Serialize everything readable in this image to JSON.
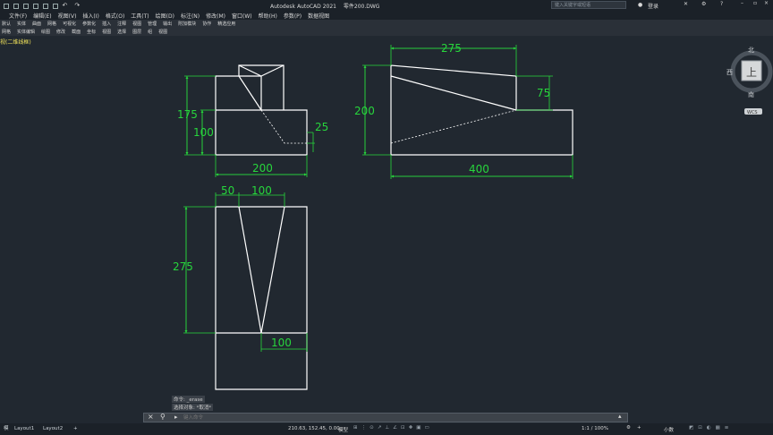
{
  "title_bar": {
    "app_title": "Autodesk AutoCAD 2021",
    "file_name": "零件200.DWG",
    "search_placeholder": "键入关键字或短语",
    "login_label": "登录"
  },
  "menu": {
    "items": [
      "文件(F)",
      "编辑(E)",
      "视图(V)",
      "插入(I)",
      "格式(O)",
      "工具(T)",
      "绘图(D)",
      "标注(N)",
      "修改(M)",
      "窗口(W)",
      "帮助(H)",
      "参数(P)",
      "数据视图"
    ]
  },
  "ribbon_tabs": {
    "items": [
      "默认",
      "实体",
      "曲面",
      "网格",
      "可视化",
      "参数化",
      "插入",
      "注释",
      "视图",
      "管理",
      "输出",
      "附加模块",
      "协作",
      "精选应用"
    ]
  },
  "panels": {
    "items": [
      "网格",
      "实体编辑",
      "绘图",
      "修改",
      "截面",
      "坐标",
      "视图",
      "选择",
      "图层",
      "组",
      "视图"
    ]
  },
  "viewport_label": "视(二维线框)",
  "viewcube": {
    "north": "北",
    "west": "西",
    "south": "南",
    "top_face": "上",
    "wcs": "WCS"
  },
  "dimensions": {
    "front_175": "175",
    "front_100": "100",
    "front_200": "200",
    "front_25": "25",
    "side_275": "275",
    "side_200": "200",
    "side_75": "75",
    "side_400": "400",
    "top_50": "50",
    "top_100a": "100",
    "top_275": "275",
    "top_100b": "100"
  },
  "command": {
    "history_1": "命令: _erase",
    "history_2": "选择对象: *取消*",
    "placeholder": "键入命令"
  },
  "status": {
    "layout_tabs": [
      "Layout1",
      "Layout2"
    ],
    "coordinates": "210.63, 152.45, 0.00",
    "model_label": "模型",
    "scale": "1:1 / 100%",
    "units": "小数"
  }
}
